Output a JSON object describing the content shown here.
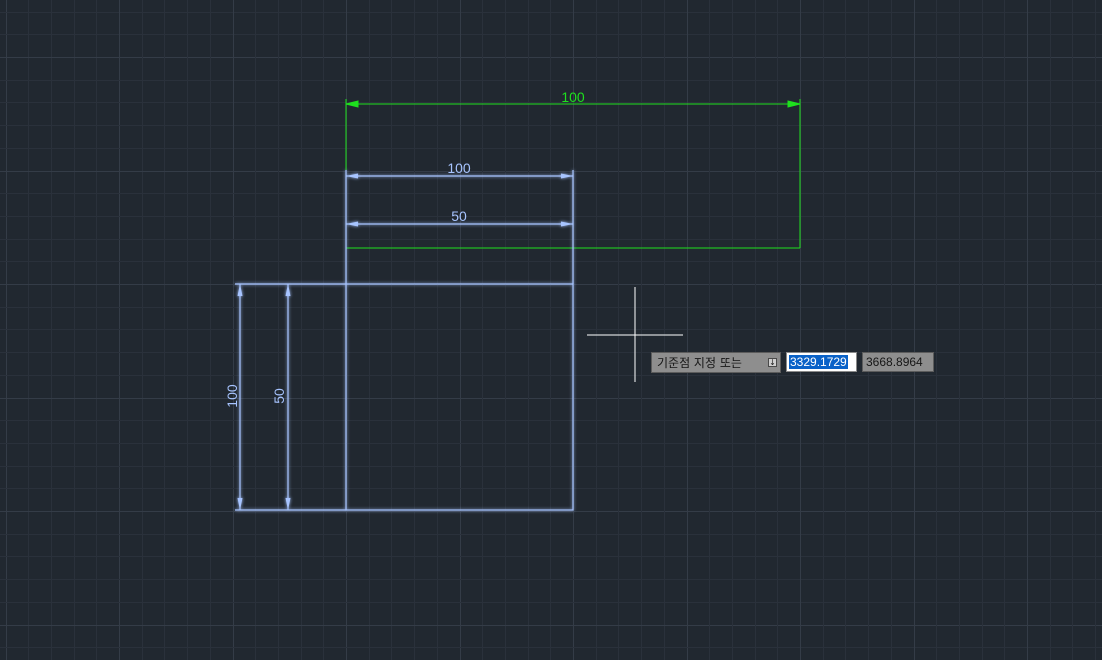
{
  "colors": {
    "background": "#212830",
    "grid_minor": "#2a313b",
    "grid_major": "#343c47",
    "geometry": "#a7c4ff",
    "glow": "#3d6bff",
    "selected_dimension": "#1ee01e",
    "crosshair": "#ffffff"
  },
  "dimensions": {
    "green_top": "100",
    "top_outer": "100",
    "top_inner": "50",
    "left_outer": "100",
    "left_inner": "50"
  },
  "dynamic_input": {
    "prompt": "기준점 지정 또는",
    "prompt_icon": "down-arrow-icon",
    "x_value": "3329.1729",
    "y_value": "3668.8964"
  }
}
